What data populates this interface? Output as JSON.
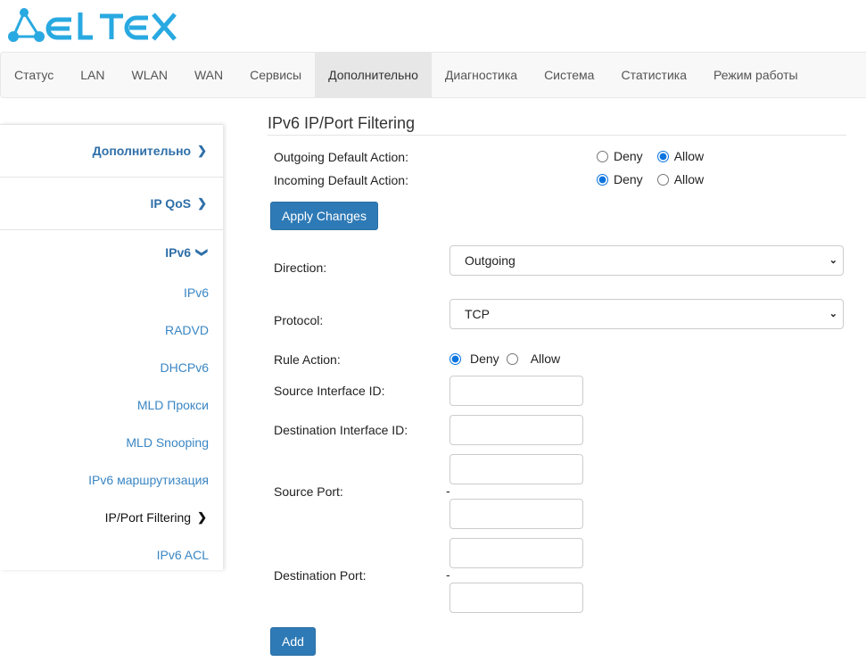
{
  "brand": {
    "logo_text": "ELTEX",
    "color": "#29a9e1"
  },
  "nav": {
    "tabs": [
      "Статус",
      "LAN",
      "WLAN",
      "WAN",
      "Сервисы",
      "Дополнительно",
      "Диагностика",
      "Система",
      "Статистика",
      "Режим работы"
    ],
    "active": "Дополнительно"
  },
  "sidebar": {
    "sections": [
      {
        "label": "Дополнительно",
        "icon": "chevron-right-icon"
      },
      {
        "label": "IP QoS",
        "icon": "chevron-right-icon"
      },
      {
        "label": "IPv6",
        "icon": "chevron-down-icon"
      }
    ],
    "items": [
      "IPv6",
      "RADVD",
      "DHCPv6",
      "MLD Прокси",
      "MLD Snooping",
      "IPv6 маршрутизация",
      "IP/Port Filtering",
      "IPv6 ACL"
    ],
    "active": "IP/Port Filtering"
  },
  "page": {
    "title": "IPv6 IP/Port Filtering",
    "outgoing_default": {
      "label": "Outgoing Default Action:",
      "deny": "Deny",
      "allow": "Allow",
      "selected": "Allow"
    },
    "incoming_default": {
      "label": "Incoming Default Action:",
      "deny": "Deny",
      "allow": "Allow",
      "selected": "Deny"
    },
    "apply_label": "Apply Changes",
    "direction": {
      "label": "Direction:",
      "value": "Outgoing"
    },
    "protocol": {
      "label": "Protocol:",
      "value": "TCP"
    },
    "rule_action": {
      "label": "Rule Action:",
      "deny": "Deny",
      "allow": "Allow",
      "selected": "Deny"
    },
    "source_interface": {
      "label": "Source Interface ID:",
      "value": ""
    },
    "dest_interface": {
      "label": "Destination Interface ID:",
      "value": ""
    },
    "source_port": {
      "label": "Source Port:",
      "separator": "-",
      "from": "",
      "to": ""
    },
    "dest_port": {
      "label": "Destination Port:",
      "separator": "-",
      "from": "",
      "to": ""
    },
    "add_label": "Add"
  }
}
